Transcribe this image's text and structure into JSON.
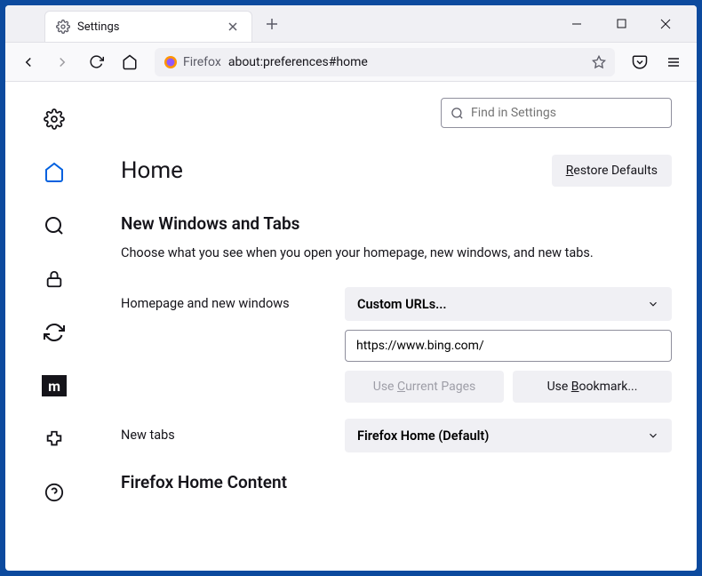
{
  "tab": {
    "title": "Settings"
  },
  "urlbar": {
    "label": "Firefox",
    "url": "about:preferences#home"
  },
  "search": {
    "placeholder": "Find in Settings"
  },
  "header": {
    "title": "Home",
    "restore": "Restore Defaults"
  },
  "section1": {
    "title": "New Windows and Tabs",
    "desc": "Choose what you see when you open your homepage, new windows, and new tabs."
  },
  "homepage": {
    "label": "Homepage and new windows",
    "dropdown": "Custom URLs...",
    "value": "https://www.bing.com/",
    "useCurrent": "Use Current Pages",
    "useBookmark": "Use Bookmark..."
  },
  "newtabs": {
    "label": "New tabs",
    "dropdown": "Firefox Home (Default)"
  },
  "section2": {
    "title": "Firefox Home Content"
  }
}
